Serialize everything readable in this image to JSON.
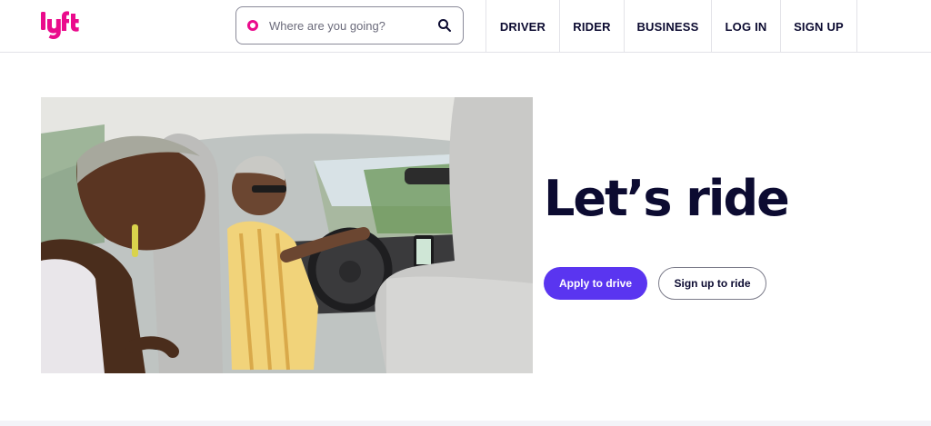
{
  "header": {
    "logo_text": "lyft",
    "search": {
      "placeholder": "Where are you going?",
      "value": ""
    },
    "nav": {
      "driver": "DRIVER",
      "rider": "RIDER",
      "business": "BUSINESS",
      "login": "LOG IN",
      "signup": "SIGN UP"
    }
  },
  "hero": {
    "title": "Let’s ride",
    "primary_button": "Apply to drive",
    "secondary_button": "Sign up to ride",
    "image_description": "photo-passenger-and-driver-in-car"
  },
  "colors": {
    "brand_pink": "#ea0b8c",
    "primary_purple": "#5a35f0",
    "text_navy": "#0c0b31"
  },
  "icons": {
    "search_pin": "location-pin-icon",
    "search_submit": "search-icon"
  }
}
